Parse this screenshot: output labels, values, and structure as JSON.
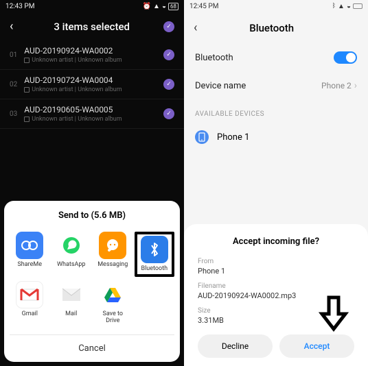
{
  "left": {
    "status": {
      "time": "12:43 PM",
      "battery": "68"
    },
    "header": {
      "title": "3 items selected"
    },
    "tracks": [
      {
        "num": "01",
        "name": "AUD-20190924-WA0002",
        "sub": "Unknown artist | Unknown album"
      },
      {
        "num": "02",
        "name": "AUD-20190724-WA0004",
        "sub": "Unknown artist | Unknown album"
      },
      {
        "num": "03",
        "name": "AUD-20190605-WA0005",
        "sub": "Unknown artist | Unknown album"
      }
    ],
    "sheet": {
      "title": "Send to (5.6 MB)",
      "apps": [
        {
          "label": "ShareMe"
        },
        {
          "label": "WhatsApp"
        },
        {
          "label": "Messaging"
        },
        {
          "label": "Bluetooth"
        },
        {
          "label": "Gmail"
        },
        {
          "label": "Mail"
        },
        {
          "label": "Save to\nDrive"
        }
      ],
      "cancel": "Cancel"
    }
  },
  "right": {
    "status": {
      "time": "12:45 PM"
    },
    "header": {
      "title": "Bluetooth"
    },
    "rows": {
      "bluetooth": "Bluetooth",
      "device_name_lbl": "Device name",
      "device_name_val": "Phone 2"
    },
    "section": "AVAILABLE DEVICES",
    "device": "Phone 1",
    "incoming": {
      "title": "Accept incoming file?",
      "from_lbl": "From",
      "from_val": "Phone 1",
      "filename_lbl": "Filename",
      "filename_val": "AUD-20190924-WA0002.mp3",
      "size_lbl": "Size",
      "size_val": "3.31MB",
      "decline": "Decline",
      "accept": "Accept"
    }
  }
}
